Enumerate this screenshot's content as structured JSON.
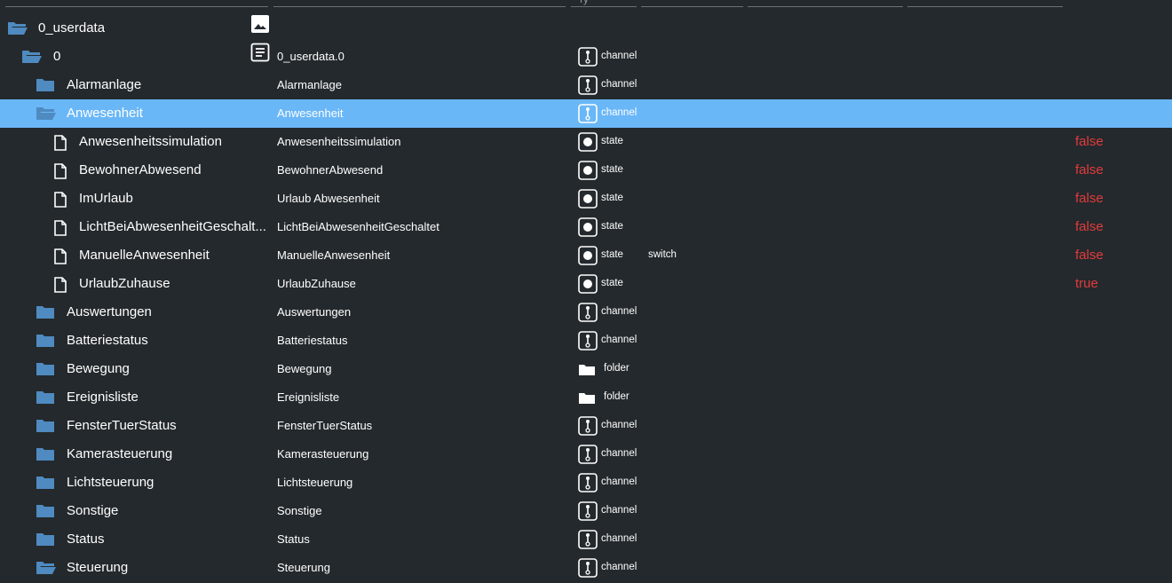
{
  "colors": {
    "background": "#24292d",
    "selected_row": "#6ab7f7",
    "folder_icon": "#4f8ac0",
    "value_red": "#e23b3b"
  },
  "header": {
    "type_hint": "ту"
  },
  "rows": [
    {
      "name": "0_userdata",
      "desc": "",
      "type": "",
      "role": "",
      "value": "",
      "icon": "folder-open-icon",
      "level": 0,
      "content": "image-icon"
    },
    {
      "name": "0",
      "desc": "0_userdata.0",
      "type": "channel",
      "role": "",
      "value": "",
      "icon": "folder-open-icon",
      "level": 1,
      "content": "description-icon"
    },
    {
      "name": "Alarmanlage",
      "desc": "Alarmanlage",
      "type": "channel",
      "role": "",
      "value": "",
      "icon": "folder-closed-icon",
      "level": 2
    },
    {
      "name": "Anwesenheit",
      "desc": "Anwesenheit",
      "type": "channel",
      "role": "",
      "value": "",
      "icon": "folder-open-icon",
      "level": 2,
      "selected": true
    },
    {
      "name": "Anwesenheitssimulation",
      "desc": "Anwesenheitssimulation",
      "type": "state",
      "role": "",
      "value": "false",
      "icon": "file-icon",
      "level": 3
    },
    {
      "name": "BewohnerAbwesend",
      "desc": "BewohnerAbwesend",
      "type": "state",
      "role": "",
      "value": "false",
      "icon": "file-icon",
      "level": 3
    },
    {
      "name": "ImUrlaub",
      "desc": "Urlaub Abwesenheit",
      "type": "state",
      "role": "",
      "value": "false",
      "icon": "file-icon",
      "level": 3
    },
    {
      "name": "LichtBeiAbwesenheitGeschalt...",
      "desc": "LichtBeiAbwesenheitGeschaltet",
      "type": "state",
      "role": "",
      "value": "false",
      "icon": "file-icon",
      "level": 3
    },
    {
      "name": "ManuelleAnwesenheit",
      "desc": "ManuelleAnwesenheit",
      "type": "state",
      "role": "switch",
      "value": "false",
      "icon": "file-icon",
      "level": 3
    },
    {
      "name": "UrlaubZuhause",
      "desc": "UrlaubZuhause",
      "type": "state",
      "role": "",
      "value": "true",
      "icon": "file-icon",
      "level": 3
    },
    {
      "name": "Auswertungen",
      "desc": "Auswertungen",
      "type": "channel",
      "role": "",
      "value": "",
      "icon": "folder-closed-icon",
      "level": 2
    },
    {
      "name": "Batteriestatus",
      "desc": "Batteriestatus",
      "type": "channel",
      "role": "",
      "value": "",
      "icon": "folder-closed-icon",
      "level": 2
    },
    {
      "name": "Bewegung",
      "desc": "Bewegung",
      "type": "folder",
      "role": "",
      "value": "",
      "icon": "folder-closed-icon",
      "level": 2
    },
    {
      "name": "Ereignisliste",
      "desc": "Ereignisliste",
      "type": "folder",
      "role": "",
      "value": "",
      "icon": "folder-closed-icon",
      "level": 2
    },
    {
      "name": "FensterTuerStatus",
      "desc": "FensterTuerStatus",
      "type": "channel",
      "role": "",
      "value": "",
      "icon": "folder-closed-icon",
      "level": 2
    },
    {
      "name": "Kamerasteuerung",
      "desc": "Kamerasteuerung",
      "type": "channel",
      "role": "",
      "value": "",
      "icon": "folder-closed-icon",
      "level": 2
    },
    {
      "name": "Lichtsteuerung",
      "desc": "Lichtsteuerung",
      "type": "channel",
      "role": "",
      "value": "",
      "icon": "folder-closed-icon",
      "level": 2
    },
    {
      "name": "Sonstige",
      "desc": "Sonstige",
      "type": "channel",
      "role": "",
      "value": "",
      "icon": "folder-closed-icon",
      "level": 2
    },
    {
      "name": "Status",
      "desc": "Status",
      "type": "channel",
      "role": "",
      "value": "",
      "icon": "folder-closed-icon",
      "level": 2
    },
    {
      "name": "Steuerung",
      "desc": "Steuerung",
      "type": "channel",
      "role": "",
      "value": "",
      "icon": "folder-open-icon",
      "level": 2
    }
  ]
}
